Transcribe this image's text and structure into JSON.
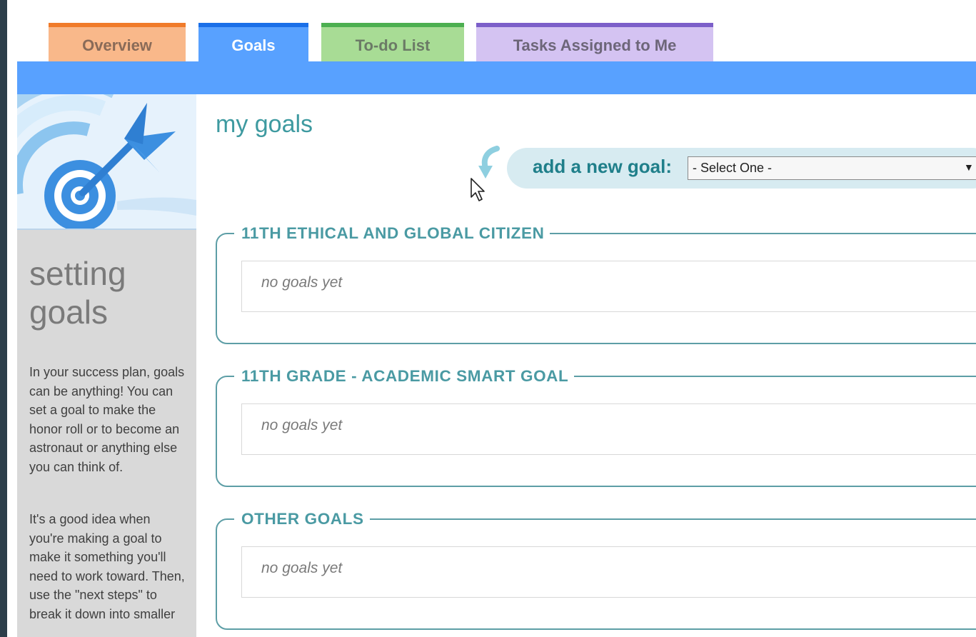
{
  "tabs": [
    {
      "label": "Overview"
    },
    {
      "label": "Goals"
    },
    {
      "label": "To-do List"
    },
    {
      "label": "Tasks Assigned to Me"
    }
  ],
  "sidebar": {
    "image_icon": "target-dart-icon",
    "title_line1": "setting",
    "title_line2": "goals",
    "paragraph1": "In your success plan, goals can be anything! You can set a goal to make the honor roll or to become an astronaut or anything else you can think of.",
    "paragraph2": "It's a good idea when you're making a goal to make it something you'll need to work toward. Then, use the \"next steps\" to break it down into smaller"
  },
  "main": {
    "title": "my goals",
    "add_goal": {
      "label": "add a new goal:",
      "select_value": "- Select One -"
    },
    "groups": [
      {
        "title": "11TH ETHICAL AND GLOBAL CITIZEN",
        "empty_text": "no goals yet"
      },
      {
        "title": "11TH GRADE - ACADEMIC SMART GOAL",
        "empty_text": "no goals yet"
      },
      {
        "title": "OTHER GOALS",
        "empty_text": "no goals yet"
      }
    ]
  },
  "colors": {
    "tab_overview": "#f9b88a",
    "tab_goals": "#58a1ff",
    "tab_todo": "#a8dc95",
    "tab_tasks": "#d4c3f2",
    "accent_teal": "#3e9aa0"
  }
}
